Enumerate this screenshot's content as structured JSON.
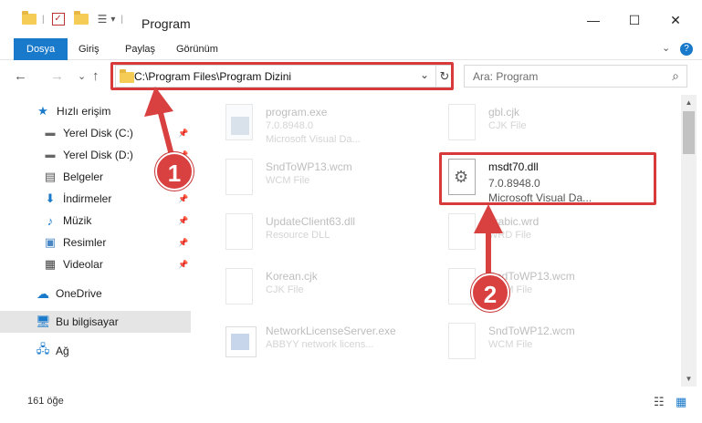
{
  "window": {
    "title": "Program",
    "minimize": "—",
    "maximize": "☐",
    "close": "✕"
  },
  "ribbon": {
    "tabs": [
      "Dosya",
      "Giriş",
      "Paylaş",
      "Görünüm"
    ],
    "expand": "⌄",
    "help": "?"
  },
  "nav": {
    "back": "←",
    "forward": "→",
    "recent": "⌄",
    "up": "↑",
    "address": "C:\\Program Files\\Program Dizini",
    "refresh": "↻",
    "dropdown": "⌄"
  },
  "search": {
    "placeholder": "Ara: Program",
    "icon": "search-icon"
  },
  "sidebar": {
    "items": [
      {
        "label": "Hızlı erişim",
        "icon": "star-icon",
        "pinned": false
      },
      {
        "label": "Yerel Disk (C:)",
        "icon": "drive-icon",
        "pinned": true
      },
      {
        "label": "Yerel Disk (D:)",
        "icon": "drive-icon",
        "pinned": true
      },
      {
        "label": "Belgeler",
        "icon": "documents-icon",
        "pinned": true
      },
      {
        "label": "İndirmeler",
        "icon": "download-icon",
        "pinned": true
      },
      {
        "label": "Müzik",
        "icon": "music-icon",
        "pinned": true
      },
      {
        "label": "Resimler",
        "icon": "pictures-icon",
        "pinned": true
      },
      {
        "label": "Videolar",
        "icon": "video-icon",
        "pinned": true
      },
      {
        "label": "OneDrive",
        "icon": "cloud-icon",
        "pinned": false
      },
      {
        "label": "Bu bilgisayar",
        "icon": "computer-icon",
        "pinned": false,
        "selected": true
      },
      {
        "label": "Ağ",
        "icon": "network-icon",
        "pinned": false
      }
    ]
  },
  "files": [
    {
      "name": "program.exe",
      "line1": "7.0.8948.0",
      "line2": "Microsoft Visual Da..."
    },
    {
      "name": "gbl.cjk",
      "line1": "CJK File",
      "line2": ""
    },
    {
      "name": "SndToWP13.wcm",
      "line1": "WCM File",
      "line2": ""
    },
    {
      "name": "msdt70.dll",
      "line1": "7.0.8948.0",
      "line2": "Microsoft Visual Da..."
    },
    {
      "name": "UpdateClient63.dll",
      "line1": "Resource DLL",
      "line2": ""
    },
    {
      "name": "arabic.wrd",
      "line1": "WRD File",
      "line2": ""
    },
    {
      "name": "Korean.cjk",
      "line1": "CJK File",
      "line2": ""
    },
    {
      "name": "SndToWP13.wcm",
      "line1": "WCM File",
      "line2": ""
    },
    {
      "name": "NetworkLicenseServer.exe",
      "line1": "ABBYY network licens...",
      "line2": ""
    },
    {
      "name": "SndToWP12.wcm",
      "line1": "WCM File",
      "line2": ""
    }
  ],
  "status": {
    "count": "161 öğe"
  },
  "annotations": {
    "step1": "1",
    "step2": "2"
  },
  "colors": {
    "accent": "#1979ca",
    "highlight": "#d73a3a"
  }
}
